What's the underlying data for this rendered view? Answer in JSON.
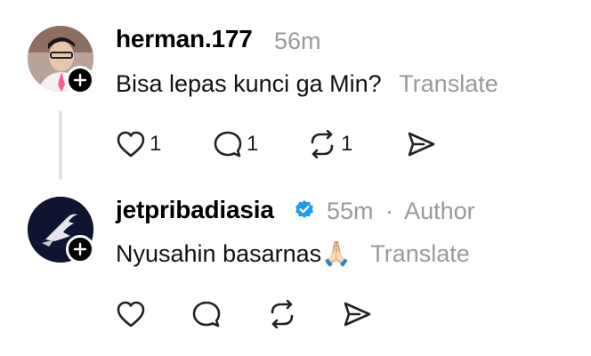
{
  "replies": [
    {
      "username": "herman.177",
      "time": "56m",
      "text": "Bisa lepas kunci ga Min?",
      "translate": "Translate",
      "likes": "1",
      "comments": "1",
      "reposts": "1"
    },
    {
      "username": "jetpribadiasia",
      "time": "55m",
      "separator": "·",
      "author_label": "Author",
      "text": "Nyusahin basarnas🙏🏻",
      "translate": "Translate",
      "verified": true
    }
  ],
  "icons": {
    "like": "heart-icon",
    "comment": "comment-icon",
    "repost": "repost-icon",
    "share": "send-icon",
    "follow": "plus-icon",
    "verified": "verified-badge-icon"
  },
  "colors": {
    "verified": "#1d9bf0",
    "muted": "#9a9a9a"
  }
}
